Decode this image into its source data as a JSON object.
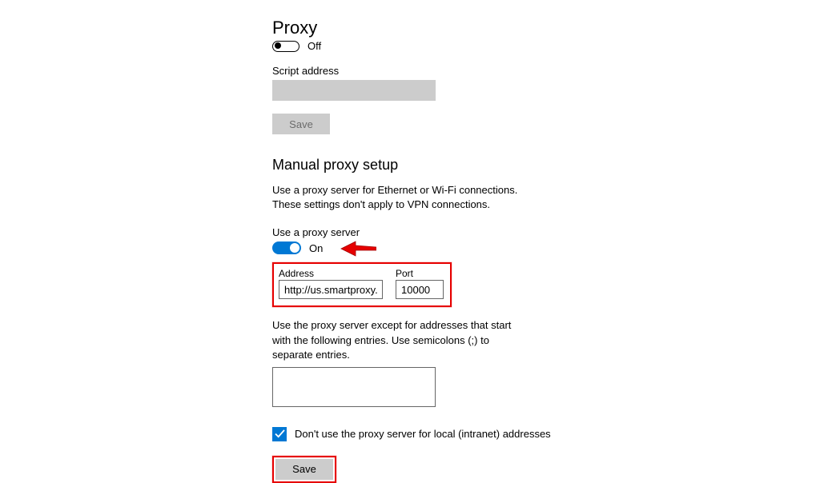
{
  "page": {
    "title": "Proxy"
  },
  "autodetect": {
    "toggle_state": "off",
    "toggle_label": "Off"
  },
  "script": {
    "label": "Script address",
    "value": "",
    "save_label": "Save"
  },
  "manual": {
    "section_title": "Manual proxy setup",
    "description": "Use a proxy server for Ethernet or Wi-Fi connections. These settings don't apply to VPN connections.",
    "use_proxy_label": "Use a proxy server",
    "toggle_state": "on",
    "toggle_label": "On",
    "address_label": "Address",
    "address_value": "http://us.smartproxy.com",
    "port_label": "Port",
    "port_value": "10000",
    "exceptions_label": "Use the proxy server except for addresses that start with the following entries. Use semicolons (;) to separate entries.",
    "exceptions_value": "",
    "bypass_local_label": "Don't use the proxy server for local (intranet) addresses",
    "bypass_local_checked": true,
    "save_label": "Save"
  },
  "annotations": {
    "arrow_color": "#e60000",
    "highlight_color": "#e60000"
  }
}
